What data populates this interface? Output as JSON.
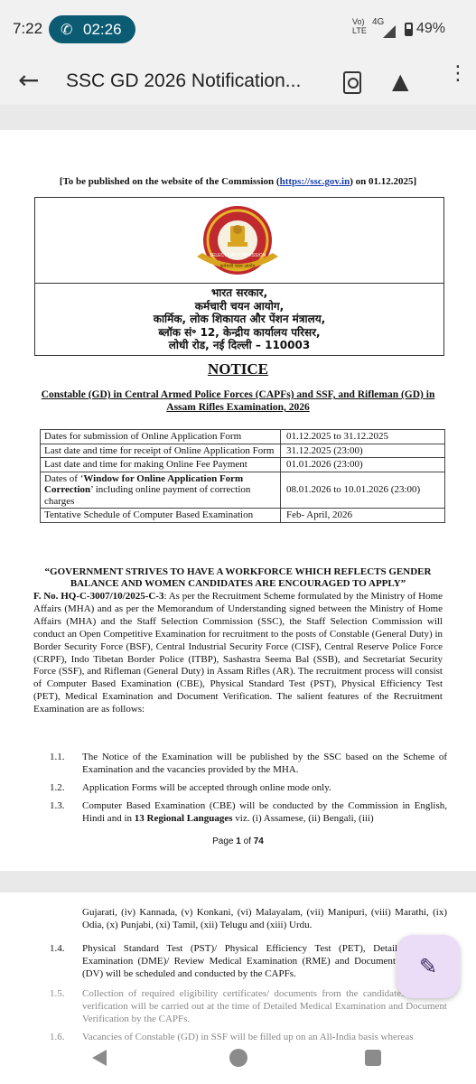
{
  "status_bar": {
    "time": "7:22",
    "call_timer": "02:26",
    "network_top": "Vo)",
    "network_bottom": "LTE",
    "network_gen": "4G",
    "battery": "49%"
  },
  "app_bar": {
    "title": "SSC GD 2026 Notification..."
  },
  "document": {
    "publish_prefix": "[To be published on the website of the Commission (",
    "publish_link": "https://ssc.gov.in",
    "publish_suffix": ") on 01.12.2025]",
    "emblem_text": "SELECTION COMMISSION",
    "emblem_hindi": "कर्मचारी चयन आयोग",
    "header_hindi": [
      "भारत सरकार,",
      "कर्मचारी चयन आयोग,",
      "कार्मिक, लोक शिकायत और पेंशन मंत्रालय,",
      "ब्लॉक सं॰ 12, केन्द्रीय कार्यालय परिसर,",
      "लोधी रोड, नई दिल्ली – 110003"
    ],
    "notice_title": "NOTICE",
    "subject": "Constable (GD) in Central Armed Police Forces (CAPFs) and SSF, and Rifleman (GD) in Assam Rifles Examination, 2026",
    "dates": [
      {
        "label": "Dates for submission of Online Application Form",
        "value": "01.12.2025 to 31.12.2025"
      },
      {
        "label": "Last date and time for receipt of Online Application Form",
        "value": "31.12.2025 (23:00)"
      },
      {
        "label": "Last date and time for making Online Fee Payment",
        "value": "01.01.2026 (23:00)"
      },
      {
        "label_prefix": "Dates of ‘",
        "label_bold": "Window for Online Application Form Correction",
        "label_suffix": "’ including online payment of correction charges",
        "value": "08.01.2026 to 10.01.2026 (23:00)"
      },
      {
        "label": "Tentative Schedule of Computer Based Examination",
        "value": "Feb- April, 2026"
      }
    ],
    "gov_statement": "“GOVERNMENT STRIVES TO HAVE A WORKFORCE WHICH REFLECTS GENDER BALANCE AND WOMEN CANDIDATES ARE ENCOURAGED TO APPLY”",
    "file_no": "F. No. HQ-C-3007/10/2025-C-3",
    "body": ": As per the Recruitment Scheme formulated by the Ministry of Home Affairs (MHA) and as per the Memorandum of Understanding signed between the Ministry of Home Affairs (MHA) and the Staff Selection Commission (SSC), the Staff Selection Commission will conduct an Open Competitive Examination for recruitment to the posts of Constable (General Duty) in Border Security Force (BSF), Central Industrial Security Force (CISF), Central Reserve Police Force (CRPF), Indo Tibetan Border Police (ITBP), Sashastra Seema Bal (SSB), and Secretariat Security Force (SSF), and Rifleman (General Duty) in Assam Rifles (AR). The recruitment process will consist of Computer Based Examination (CBE), Physical Standard Test (PST), Physical Efficiency Test (PET), Medical Examination and Document Verification. The salient features of the Recruitment Examination are as follows:",
    "items": [
      {
        "num": "1.1.",
        "text": "The Notice of the Examination will be published by the SSC based on the Scheme of Examination and the vacancies provided by the MHA."
      },
      {
        "num": "1.2.",
        "text": "Application Forms will be accepted through online mode only."
      },
      {
        "num": "1.3.",
        "text_prefix": "Computer Based Examination (CBE) will be conducted by the Commission in English, Hindi and in ",
        "text_bold": "13 Regional Languages",
        "text_suffix": " viz. (i) Assamese, (ii) Bengali, (iii)"
      }
    ],
    "page_prefix": "Page ",
    "page_current": "1",
    "page_of": " of ",
    "page_total": "74",
    "page2_continuation": "Gujarati, (iv) Kannada, (v) Konkani, (vi) Malayalam, (vii) Manipuri, (viii) Marathi, (ix) Odia, (x) Punjabi, (xi) Tamil, (xii) Telugu and (xiii) Urdu.",
    "page2_items": [
      {
        "num": "1.4.",
        "text": "Physical Standard Test (PST)/ Physical Efficiency Test (PET), Detailed Medical Examination (DME)/ Review Medical Examination (RME) and Document Verification (DV) will be scheduled and conducted by the CAPFs."
      },
      {
        "num": "1.5.",
        "text": "Collection of required eligibility certificates/ documents from the candidates and their verification will be carried out at the time of Detailed Medical Examination and Document Verification by the CAPFs."
      },
      {
        "num": "1.6.",
        "text": "Vacancies of Constable (GD) in SSF will be filled up on an All-India basis whereas"
      }
    ]
  },
  "icons": {
    "back": "←",
    "phone": "✆",
    "drive_add": "▲",
    "more": "⋮",
    "edit": "✎"
  }
}
